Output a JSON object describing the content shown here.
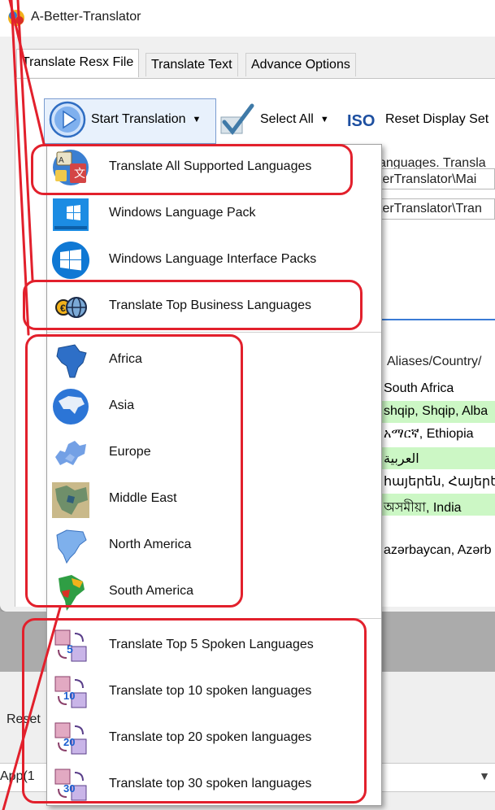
{
  "window": {
    "title": "A-Better-Translator"
  },
  "tabs": [
    {
      "label": "Translate Resx File",
      "active": true
    },
    {
      "label": "Translate Text",
      "active": false
    },
    {
      "label": "Advance Options",
      "active": false
    }
  ],
  "toolbar": {
    "start_translation": "Start Translation",
    "select_all": "Select All",
    "reset_display": "Reset Display Set"
  },
  "background": {
    "info_text": "anguages.  Transla",
    "path1": "terTranslator\\Mai",
    "path2": "terTranslator\\Tran",
    "grid_header": "Aliases/Country/",
    "rows": [
      {
        "text": "South Africa",
        "green": false
      },
      {
        "text": "shqip, Shqip, Alba",
        "green": true
      },
      {
        "text": "አማርኛ, Ethiopia",
        "green": false
      },
      {
        "text": "العربية",
        "green": true
      },
      {
        "text": "հայերեն, Հայերե",
        "green": false
      },
      {
        "text": "অসমীয়া, India",
        "green": true
      },
      {
        "text": "",
        "green": false
      },
      {
        "text": "azərbaycan, Azərb",
        "green": false
      }
    ],
    "reset_label": "Reset",
    "combo_text": "App(1"
  },
  "menu": {
    "items": [
      {
        "label": "Translate All Supported Languages",
        "icon": "translate-abc-icon"
      },
      {
        "label": "Windows Language Pack",
        "icon": "windows-icon"
      },
      {
        "label": "Windows Language Interface Packs",
        "icon": "windows-logo-icon"
      },
      {
        "label": "Translate Top Business Languages",
        "icon": "business-globe-icon"
      },
      {
        "label": "Africa",
        "icon": "africa-map-icon"
      },
      {
        "label": "Asia",
        "icon": "asia-map-icon"
      },
      {
        "label": "Europe",
        "icon": "europe-map-icon"
      },
      {
        "label": "Middle East",
        "icon": "middle-east-map-icon"
      },
      {
        "label": "North America",
        "icon": "north-america-map-icon"
      },
      {
        "label": "South America",
        "icon": "south-america-map-icon"
      },
      {
        "label": "Translate Top 5 Spoken Languages",
        "icon": "top-5-icon"
      },
      {
        "label": "Translate top 10 spoken languages",
        "icon": "top-10-icon"
      },
      {
        "label": "Translate top 20 spoken languages",
        "icon": "top-20-icon"
      },
      {
        "label": "Translate top 30 spoken languages",
        "icon": "top-30-icon"
      }
    ]
  },
  "colors": {
    "highlight": "#e2202c",
    "green_row": "#ccf7c5",
    "accent_blue": "#3a7bd5"
  }
}
